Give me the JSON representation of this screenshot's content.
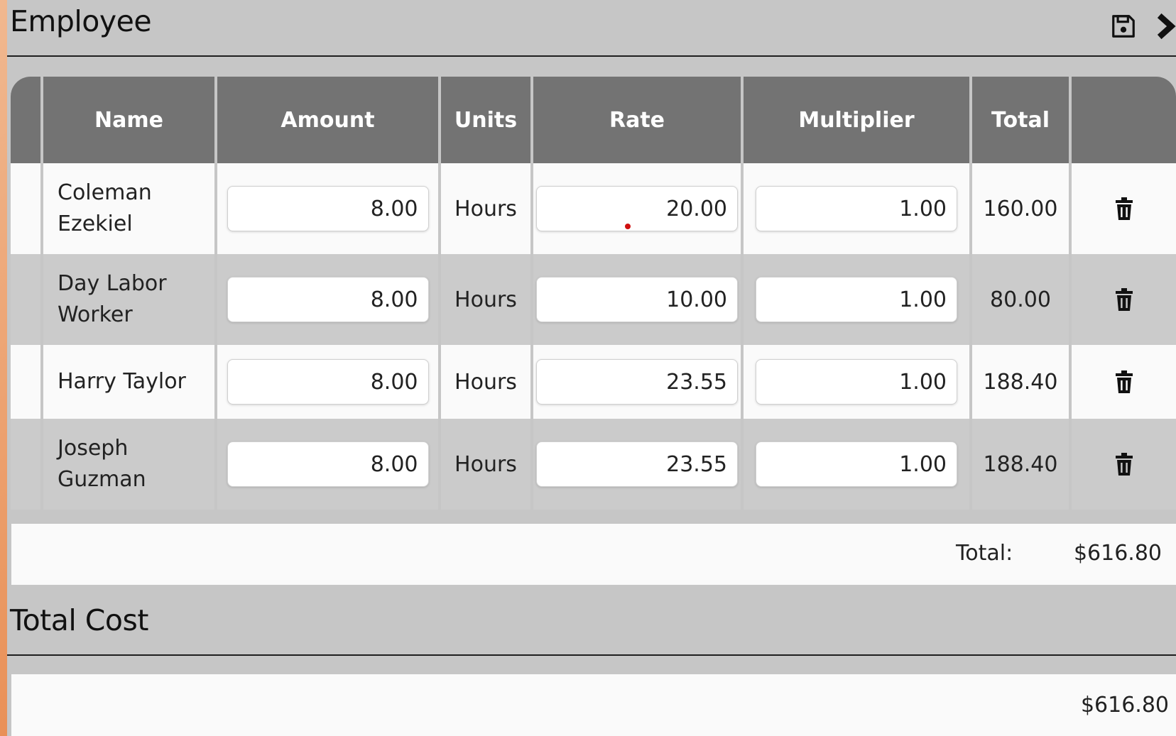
{
  "employee_section": {
    "title": "Employee",
    "icons": [
      "save-icon",
      "chevron-right-icon"
    ]
  },
  "table": {
    "columns": [
      "",
      "Name",
      "Amount",
      "Units",
      "Rate",
      "Multiplier",
      "Total",
      ""
    ],
    "rows": [
      {
        "name_line1": "Coleman",
        "name_line2": "Ezekiel",
        "amount": "8.00",
        "units": "Hours",
        "rate": "20.00",
        "multiplier": "1.00",
        "total": "160.00"
      },
      {
        "name_line1": "Day Labor",
        "name_line2": "Worker",
        "amount": "8.00",
        "units": "Hours",
        "rate": "10.00",
        "multiplier": "1.00",
        "total": "80.00"
      },
      {
        "name_line1": "Harry Taylor",
        "name_line2": "",
        "amount": "8.00",
        "units": "Hours",
        "rate": "23.55",
        "multiplier": "1.00",
        "total": "188.40"
      },
      {
        "name_line1": "Joseph",
        "name_line2": "Guzman",
        "amount": "8.00",
        "units": "Hours",
        "rate": "23.55",
        "multiplier": "1.00",
        "total": "188.40"
      }
    ],
    "row_action_icon": "trash-icon"
  },
  "summary": {
    "label": "Total:",
    "value": "$616.80"
  },
  "total_cost_section": {
    "title": "Total Cost",
    "value": "$616.80"
  },
  "colors": {
    "header_bg": "#737373",
    "panel_bg": "#c6c6c6",
    "row_alt_bg": "#cbcbcb",
    "row_bg": "#fafafa"
  }
}
